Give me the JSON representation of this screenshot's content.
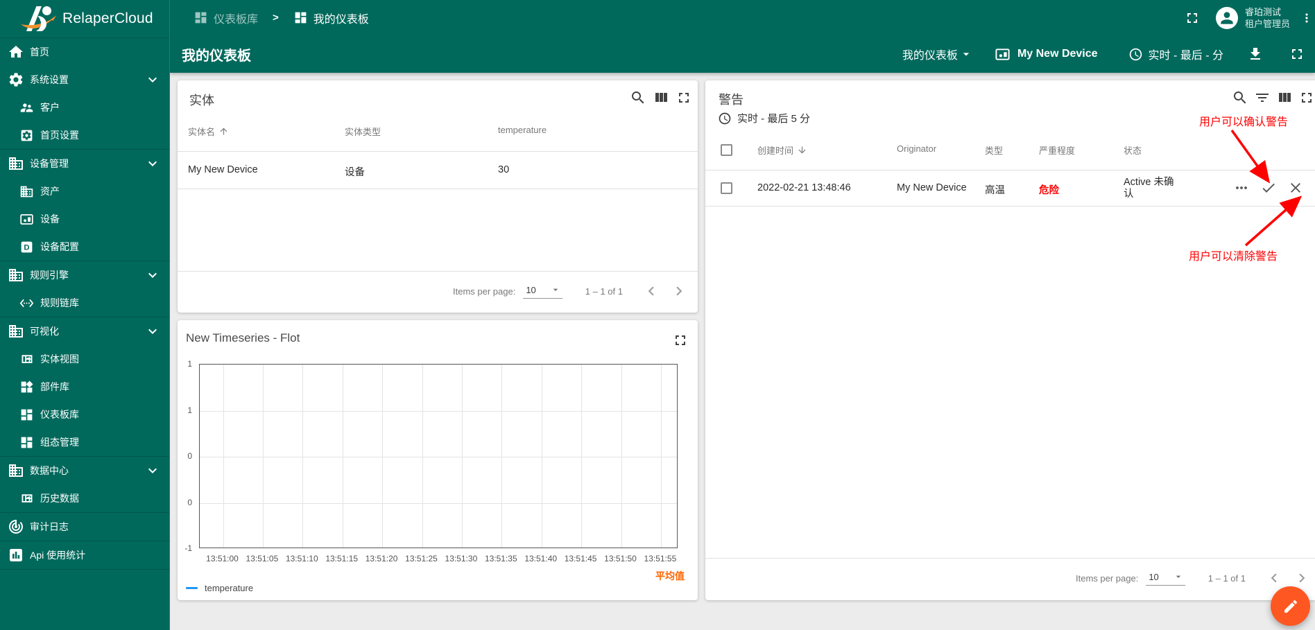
{
  "brand": {
    "name": "RelaperCloud"
  },
  "sidebar": {
    "items": [
      {
        "label": "首页",
        "icon": "home"
      },
      {
        "label": "系统设置",
        "icon": "settings",
        "expandable": true
      },
      {
        "label": "客户",
        "icon": "people"
      },
      {
        "label": "首页设置",
        "icon": "settings-applications"
      },
      {
        "label": "设备管理",
        "icon": "domain",
        "expandable": true
      },
      {
        "label": "资产",
        "icon": "domain"
      },
      {
        "label": "设备",
        "icon": "devices"
      },
      {
        "label": "设备配置",
        "icon": "device-profile"
      },
      {
        "label": "规则引擎",
        "icon": "domain",
        "expandable": true
      },
      {
        "label": "规则链库",
        "icon": "settings-ethernet"
      },
      {
        "label": "可视化",
        "icon": "domain",
        "expandable": true
      },
      {
        "label": "实体视图",
        "icon": "view-quilt"
      },
      {
        "label": "部件库",
        "icon": "widgets"
      },
      {
        "label": "仪表板库",
        "icon": "dashboard"
      },
      {
        "label": "组态管理",
        "icon": "dashboard"
      },
      {
        "label": "数据中心",
        "icon": "domain",
        "expandable": true
      },
      {
        "label": "历史数据",
        "icon": "view-quilt"
      },
      {
        "label": "审计日志",
        "icon": "track-changes"
      },
      {
        "label": "Api 使用统计",
        "icon": "insert-chart"
      }
    ]
  },
  "header": {
    "breadcrumb": [
      {
        "label": "仪表板库"
      },
      {
        "label": "我的仪表板"
      }
    ],
    "separator": ">",
    "user_name": "睿珀测试",
    "user_role": "租户管理员"
  },
  "toolbar": {
    "title": "我的仪表板",
    "dashboard_select": "我的仪表板",
    "device_label": "My New Device",
    "timewindow": "实时 - 最后 - 分"
  },
  "entities_card": {
    "title": "实体",
    "columns": {
      "name": "实体名",
      "type": "实体类型",
      "temperature": "temperature"
    },
    "row": {
      "name": "My New Device",
      "type": "设备",
      "temperature": "30"
    },
    "paginator": {
      "label": "Items per page:",
      "page_size": "10",
      "range": "1 – 1 of 1"
    }
  },
  "alarms_card": {
    "title": "警告",
    "timewindow": "实时 - 最后 5 分",
    "columns": {
      "created_time": "创建时间",
      "originator": "Originator",
      "type": "类型",
      "severity": "严重程度",
      "status": "状态"
    },
    "row": {
      "created_time": "2022-02-21 13:48:46",
      "originator": "My New Device",
      "type": "高温",
      "severity": "危险",
      "status": "Active 未确认"
    },
    "annotations": {
      "ack": "用户可以确认警告",
      "clear": "用户可以清除警告"
    },
    "paginator": {
      "label": "Items per page:",
      "page_size": "10",
      "range": "1 – 1 of 1"
    }
  },
  "chart_card": {
    "title": "New Timeseries - Flot",
    "legend": "temperature",
    "aggregation_label": "平均值"
  },
  "chart_data": {
    "type": "line",
    "title": "New Timeseries - Flot",
    "series": [
      {
        "name": "temperature",
        "color": "#2196f3",
        "values": []
      }
    ],
    "x_ticks": [
      "13:51:00",
      "13:51:05",
      "13:51:10",
      "13:51:15",
      "13:51:20",
      "13:51:25",
      "13:51:30",
      "13:51:35",
      "13:51:40",
      "13:51:45",
      "13:51:50",
      "13:51:55"
    ],
    "y_ticks": [
      "1",
      "1",
      "0",
      "0",
      "-1"
    ],
    "ylim": [
      -1,
      1
    ],
    "grid": true,
    "legend_position": "bottom-left"
  },
  "colors": {
    "primary": "#00695c",
    "accent": "#ff5722",
    "alert_red": "#ff0000",
    "series_blue": "#2196f3",
    "aggregation_orange": "#ff6600",
    "content_bg": "#ececec"
  }
}
